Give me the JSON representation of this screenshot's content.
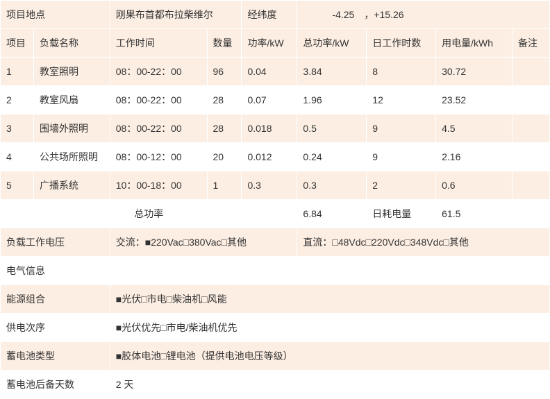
{
  "labels": {
    "project_location": "项目地点",
    "location_value": "刚果布首都布拉柴维尔",
    "coords_label": "经纬度",
    "coords_value": "　　　-4.25　，+15.26",
    "col_item": "项目",
    "col_load_name": "负载名称",
    "col_work_time": "工作时间",
    "col_qty": "数量",
    "col_power": "功率/kW",
    "col_total_power": "总功率/kW",
    "col_daily_hours": "日工作时数",
    "col_energy": "用电量/kWh",
    "col_note": "备注",
    "total_power_label": "总功率",
    "daily_energy_label": "日耗电量",
    "load_voltage": "负载工作电压",
    "ac_voltage": "交流：■220Vac□380Vac□其他",
    "dc_voltage": "直流：□48Vdc□220Vdc□348Vdc□其他",
    "elec_info": "电气信息",
    "energy_combo_label": "能源组合",
    "energy_combo_value": "■光伏□市电□柴油机□风能",
    "power_order_label": "供电次序",
    "power_order_value": "■光伏优先□市电/柴油机优先",
    "battery_type_label": "蓄电池类型",
    "battery_type_value": "■胶体电池□锂电池（提供电池电压等级）",
    "battery_backup_label": "蓄电池后备天数",
    "battery_backup_value": "2 天"
  },
  "rows": [
    {
      "id": "1",
      "name": "教室照明",
      "time": "08：00-22：00",
      "qty": "96",
      "power": "0.04",
      "total": "3.84",
      "hours": "8",
      "energy": "30.72",
      "note": ""
    },
    {
      "id": "2",
      "name": "教室风扇",
      "time": "08：00-22：00",
      "qty": "28",
      "power": "0.07",
      "total": "1.96",
      "hours": "12",
      "energy": "23.52",
      "note": ""
    },
    {
      "id": "3",
      "name": "围墙外照明",
      "time": "08：00-22：00",
      "qty": "28",
      "power": "0.018",
      "total": "0.5",
      "hours": "9",
      "energy": "4.5",
      "note": ""
    },
    {
      "id": "4",
      "name": "公共场所照明",
      "time": "08：00-12：00",
      "qty": "20",
      "power": "0.012",
      "total": "0.24",
      "hours": "9",
      "energy": "2.16",
      "note": ""
    },
    {
      "id": "5",
      "name": "广播系统",
      "time": "10：00-18：00",
      "qty": "1",
      "power": "0.3",
      "total": "0.3",
      "hours": "2",
      "energy": "0.6",
      "note": ""
    }
  ],
  "totals": {
    "power": "6.84",
    "energy": "61.5"
  },
  "chart_data": {
    "type": "table",
    "title": "负载及电气信息",
    "columns": [
      "项目",
      "负载名称",
      "工作时间",
      "数量",
      "功率/kW",
      "总功率/kW",
      "日工作时数",
      "用电量/kWh",
      "备注"
    ],
    "rows": [
      [
        "1",
        "教室照明",
        "08：00-22：00",
        96,
        0.04,
        3.84,
        8,
        30.72,
        ""
      ],
      [
        "2",
        "教室风扇",
        "08：00-22：00",
        28,
        0.07,
        1.96,
        12,
        23.52,
        ""
      ],
      [
        "3",
        "围墙外照明",
        "08：00-22：00",
        28,
        0.018,
        0.5,
        9,
        4.5,
        ""
      ],
      [
        "4",
        "公共场所照明",
        "08：00-12：00",
        20,
        0.012,
        0.24,
        9,
        2.16,
        ""
      ],
      [
        "5",
        "广播系统",
        "10：00-18：00",
        1,
        0.3,
        0.3,
        2,
        0.6,
        ""
      ]
    ],
    "totals": {
      "总功率/kW": 6.84,
      "日耗电量/kWh": 61.5
    }
  }
}
